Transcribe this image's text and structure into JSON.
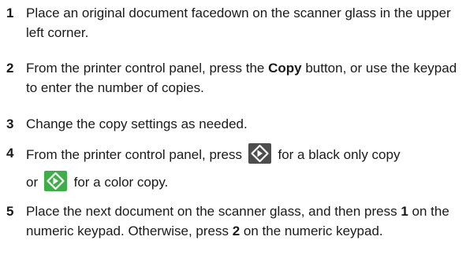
{
  "steps": [
    {
      "number": "1",
      "text": "Place an original document facedown on the scanner glass in the upper left corner."
    },
    {
      "number": "2",
      "text_before": "From the printer control panel, press the ",
      "bold": "Copy",
      "text_after": " button, or use the keypad to enter the number of copies."
    },
    {
      "number": "3",
      "text": "Change the copy settings as needed."
    },
    {
      "number": "4",
      "text_before": "From the printer control panel, press",
      "text_middle": "for a black only copy",
      "text_or": "or",
      "text_after": "for a color copy.",
      "black_button_icon": "black-start-icon",
      "color_button_icon": "color-start-icon",
      "black_button_color": "#4d4d4d",
      "color_button_color": "#3fae49"
    },
    {
      "number": "5",
      "text_a": "Place the next document on the scanner glass, and then press ",
      "bold_a": "1",
      "text_b": " on the numeric keypad. Otherwise, press ",
      "bold_b": "2",
      "text_c": " on the numeric keypad."
    }
  ]
}
